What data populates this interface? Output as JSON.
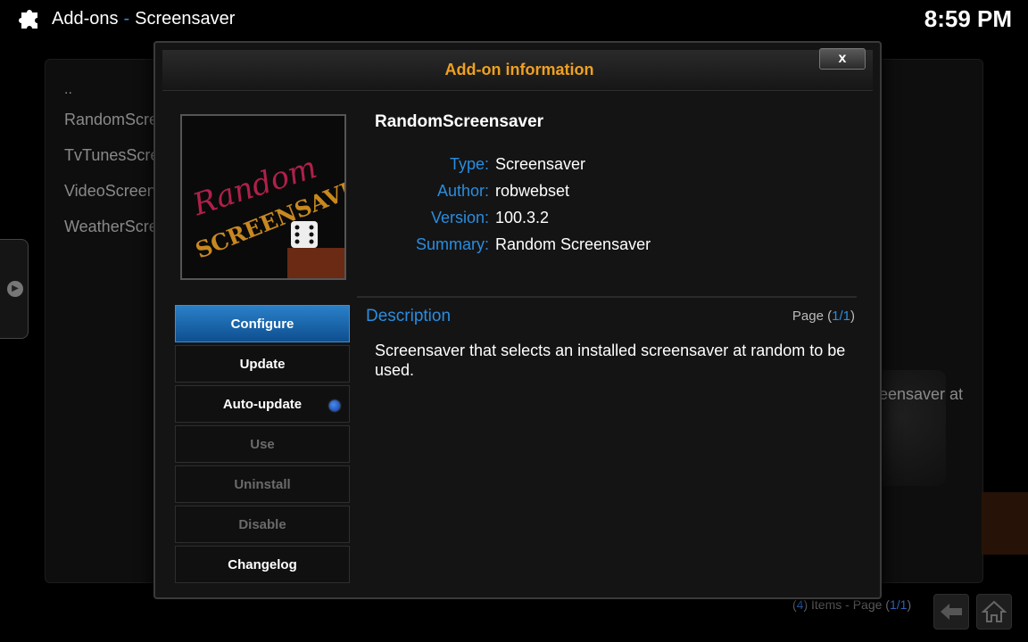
{
  "header": {
    "section": "Add-ons",
    "separator": "-",
    "subsection": "Screensaver",
    "time": "8:59 PM"
  },
  "background_list": {
    "items": [
      "..",
      "RandomScreensaver",
      "TvTunesScreensaver",
      "VideoScreensaver",
      "WeatherScreensaver"
    ],
    "right_text": "eensaver at"
  },
  "footer": {
    "items_count": "4",
    "items_label": "Items - Page",
    "page": "1/1"
  },
  "dialog": {
    "title": "Add-on information",
    "close_label": "x",
    "addon_name": "RandomScreensaver",
    "thumbnail_text_line1": "Random",
    "thumbnail_text_line2": "SCREENSAVER",
    "fields": [
      {
        "label": "Type:",
        "value": "Screensaver"
      },
      {
        "label": "Author:",
        "value": "robwebset"
      },
      {
        "label": "Version:",
        "value": "100.3.2"
      },
      {
        "label": "Summary:",
        "value": "Random Screensaver"
      }
    ],
    "description_title": "Description",
    "page_label": "Page",
    "page_value": "1/1",
    "description": "Screensaver that selects an installed screensaver at random to be used.",
    "buttons": [
      {
        "label": "Configure",
        "state": "focused"
      },
      {
        "label": "Update",
        "state": "enabled"
      },
      {
        "label": "Auto-update",
        "state": "enabled",
        "toggle_on": true
      },
      {
        "label": "Use",
        "state": "disabled"
      },
      {
        "label": "Uninstall",
        "state": "disabled"
      },
      {
        "label": "Disable",
        "state": "disabled"
      },
      {
        "label": "Changelog",
        "state": "enabled"
      }
    ]
  },
  "colors": {
    "accent_blue": "#2a8de0",
    "title_orange": "#f0a020",
    "focus_blue": "#1a6ab0"
  }
}
